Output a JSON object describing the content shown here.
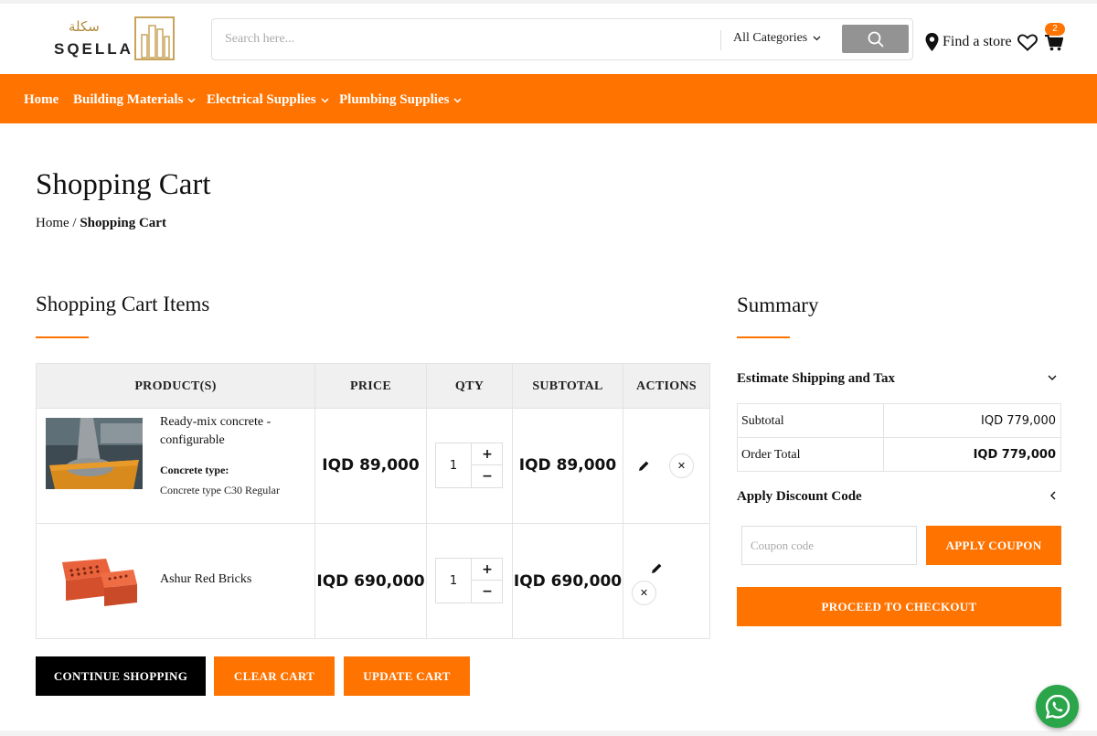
{
  "header": {
    "logo_text": "SQELLA",
    "logo_arabic": "سكلة",
    "search_placeholder": "Search here...",
    "category_select": "All Categories",
    "find_store": "Find a store",
    "cart_count": "2"
  },
  "nav": {
    "items": [
      {
        "label": "Home"
      },
      {
        "label": "Building Materials"
      },
      {
        "label": "Electrical Supplies"
      },
      {
        "label": "Plumbing Supplies"
      }
    ]
  },
  "page": {
    "title": "Shopping Cart",
    "breadcrumb_home": "Home",
    "breadcrumb_sep": "/",
    "breadcrumb_current": "Shopping Cart"
  },
  "cart": {
    "title": "Shopping Cart Items",
    "columns": [
      "PRODUCT(S)",
      "PRICE",
      "QTY",
      "SUBTOTAL",
      "ACTIONS"
    ],
    "items": [
      {
        "name": "Ready-mix concrete - configurable",
        "option_label": "Concrete type:",
        "option_value": "Concrete type C30 Regular",
        "price": "IQD 89,000",
        "qty": "1",
        "subtotal": "IQD 89,000"
      },
      {
        "name": "Ashur Red Bricks",
        "price": "IQD 690,000",
        "qty": "1",
        "subtotal": "IQD 690,000"
      }
    ],
    "buttons": {
      "continue": "CONTINUE SHOPPING",
      "clear": "CLEAR CART",
      "update": "UPDATE CART"
    }
  },
  "summary": {
    "title": "Summary",
    "estimate": "Estimate Shipping and Tax",
    "subtotal_label": "Subtotal",
    "subtotal_value": "IQD 779,000",
    "order_total_label": "Order Total",
    "order_total_value": "IQD 779,000",
    "discount_title": "Apply Discount Code",
    "coupon_placeholder": "Coupon code",
    "apply_coupon": "APPLY COUPON",
    "checkout": "PROCEED TO CHECKOUT"
  },
  "colors": {
    "accent": "#ff7300",
    "search_button": "#939393",
    "whatsapp": "#2aa54a"
  },
  "icons": [
    "search-icon",
    "chevron-down-icon",
    "map-pin-icon",
    "heart-icon",
    "cart-icon",
    "pencil-icon",
    "close-icon",
    "chevron-left-icon",
    "whatsapp-icon"
  ]
}
